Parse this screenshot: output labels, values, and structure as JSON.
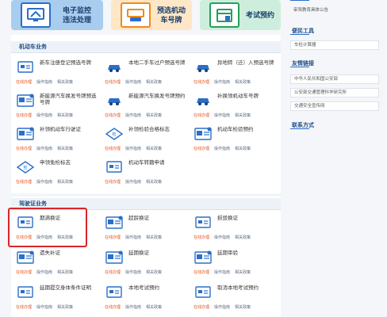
{
  "banners": [
    {
      "line1": "电子监控",
      "line2": "违法处理",
      "icon": "monitor-icon"
    },
    {
      "line1": "预选机动",
      "line2": "车号牌",
      "icon": "license-plate-icon"
    },
    {
      "line1": "考试预约",
      "line2": "",
      "icon": "calendar-icon"
    }
  ],
  "sections": {
    "vehicle": "机动车业务",
    "driver": "驾驶证业务"
  },
  "link_labels": {
    "online": "在线办理",
    "guide": "操作指南",
    "notes": "相关政策"
  },
  "vehicle_items": [
    {
      "title": "新车注册登记预选号牌"
    },
    {
      "title": "本地二手车过户预选号牌"
    },
    {
      "title": "异地转（迁）入预选号牌"
    },
    {
      "title": "新能源汽车换发号牌预选号牌"
    },
    {
      "title": "新能源汽车换发号牌预约"
    },
    {
      "title": "补换领机动车号牌"
    },
    {
      "title": "补领机动车行驶证"
    },
    {
      "title": "补领检验合格标志"
    },
    {
      "title": "机动车检验预约"
    },
    {
      "title": "申领免检标志"
    },
    {
      "title": "机动车转籍申请"
    }
  ],
  "driver_items": [
    {
      "title": "期满换证"
    },
    {
      "title": "超龄换证"
    },
    {
      "title": "损毁换证"
    },
    {
      "title": "遗失补证"
    },
    {
      "title": "延期换证"
    },
    {
      "title": "延期审验"
    },
    {
      "title": "延期提交身体条件证明"
    },
    {
      "title": "本地考试预约"
    },
    {
      "title": "取消本地考试预约"
    }
  ],
  "sidebar": {
    "top_notice": "审驾教育具体公告",
    "tools_title": "便民工具",
    "tools": [
      "车检计算器"
    ],
    "links_title": "友情链接",
    "links": [
      "中华人民共和国公安部",
      "公安部交通管理科学研究所",
      "交通安全宣传网"
    ],
    "contact_title": "联系方式"
  }
}
